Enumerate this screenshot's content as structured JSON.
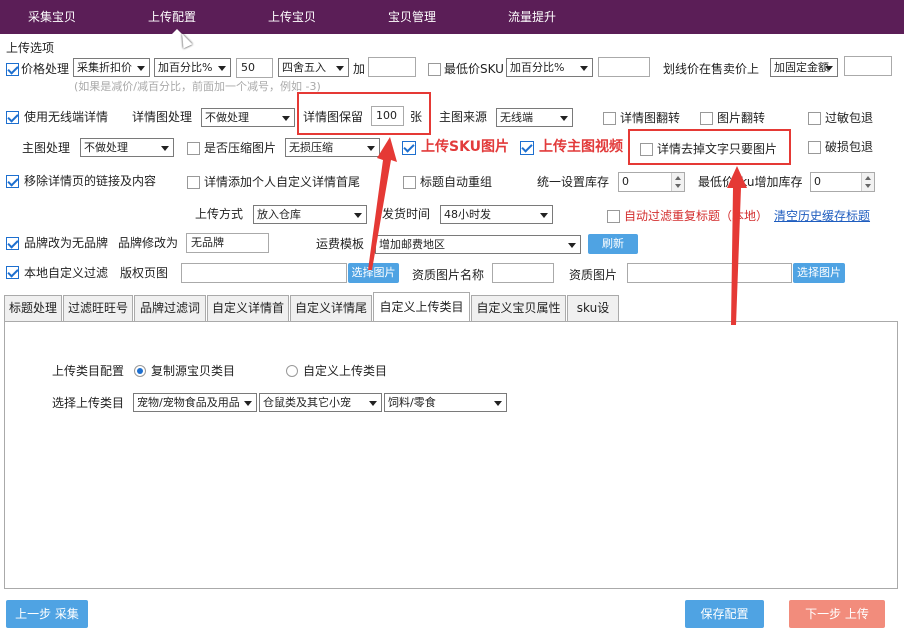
{
  "nav": [
    "采集宝贝",
    "上传配置",
    "上传宝贝",
    "宝贝管理",
    "流量提升"
  ],
  "section_title": "上传选项",
  "row1": {
    "price_label": "价格处理",
    "price_mode": "采集折扣价",
    "price_calc": "加百分比%",
    "price_value": "50",
    "rounding": "四舍五入",
    "plus": "加",
    "plus_value": "",
    "min_sku_label": "最低价SKU",
    "min_sku_calc": "加百分比%",
    "min_sku_value": "",
    "line_price_label": "划线价在售卖价上",
    "line_price_mode": "加固定金额",
    "line_price_value": ""
  },
  "hint": "(如果是减价/减百分比，前面加一个减号，例如 -3)",
  "row2": {
    "wireless": "使用无线端详情",
    "detail_proc_label": "详情图处理",
    "detail_proc": "不做处理",
    "detail_keep_label": "详情图保留",
    "detail_keep_value": "100",
    "detail_keep_unit": "张",
    "main_src_label": "主图来源",
    "main_src": "无线端",
    "detail_flip": "详情图翻转",
    "img_flip": "图片翻转",
    "sensitive": "过敏包退"
  },
  "row3": {
    "main_proc_label": "主图处理",
    "main_proc": "不做处理",
    "compress": "是否压缩图片",
    "compress_mode": "无损压缩",
    "upload_sku": "上传SKU图片",
    "upload_video": "上传主图视频",
    "remove_text": "详情去掉文字只要图片",
    "broken": "破损包退"
  },
  "row4": {
    "remove_links": "移除详情页的链接及内容",
    "add_header": "详情添加个人自定义详情首尾",
    "auto_regroup": "标题自动重组",
    "stock_label": "统一设置库存",
    "stock_value": "0",
    "min_sku_stock_label": "最低价sku增加库存",
    "min_sku_stock_value": "0"
  },
  "row5": {
    "upload_method_label": "上传方式",
    "upload_method": "放入仓库",
    "ship_time_label": "发货时间",
    "ship_time": "48小时发",
    "auto_filter": "自动过滤重复标题（本地）",
    "clear_cache": "清空历史缓存标题"
  },
  "row6": {
    "brand_change": "品牌改为无品牌",
    "brand_to_label": "品牌修改为",
    "brand_to_value": "无品牌",
    "freight_label": "运费模板",
    "freight": "增加邮费地区",
    "refresh": "刷新"
  },
  "row7": {
    "local_filter": "本地自定义过滤",
    "copyright_label": "版权页图",
    "copyright_value": "",
    "select_img": "选择图片",
    "qual_name_label": "资质图片名称",
    "qual_name_value": "",
    "qual_img_label": "资质图片",
    "qual_img_value": "",
    "select_img2": "选择图片"
  },
  "tabs": [
    "标题处理",
    "过滤旺旺号",
    "品牌过滤词",
    "自定义详情首",
    "自定义详情尾",
    "自定义上传类目",
    "自定义宝贝属性",
    "sku设置"
  ],
  "panel": {
    "config_label": "上传类目配置",
    "copy_src": "复制源宝贝类目",
    "custom_cat": "自定义上传类目",
    "choose_label": "选择上传类目",
    "cat1": "宠物/宠物食品及用品",
    "cat2": "仓鼠类及其它小宠",
    "cat3": "饲料/零食"
  },
  "buttons": {
    "prev": "上一步 采集",
    "save": "保存配置",
    "next": "下一步 上传"
  },
  "colors": {
    "nav_bg": "#5b1e57",
    "accent": "#4fa3e3",
    "next": "#f28c7c",
    "annotation": "#e53935"
  }
}
